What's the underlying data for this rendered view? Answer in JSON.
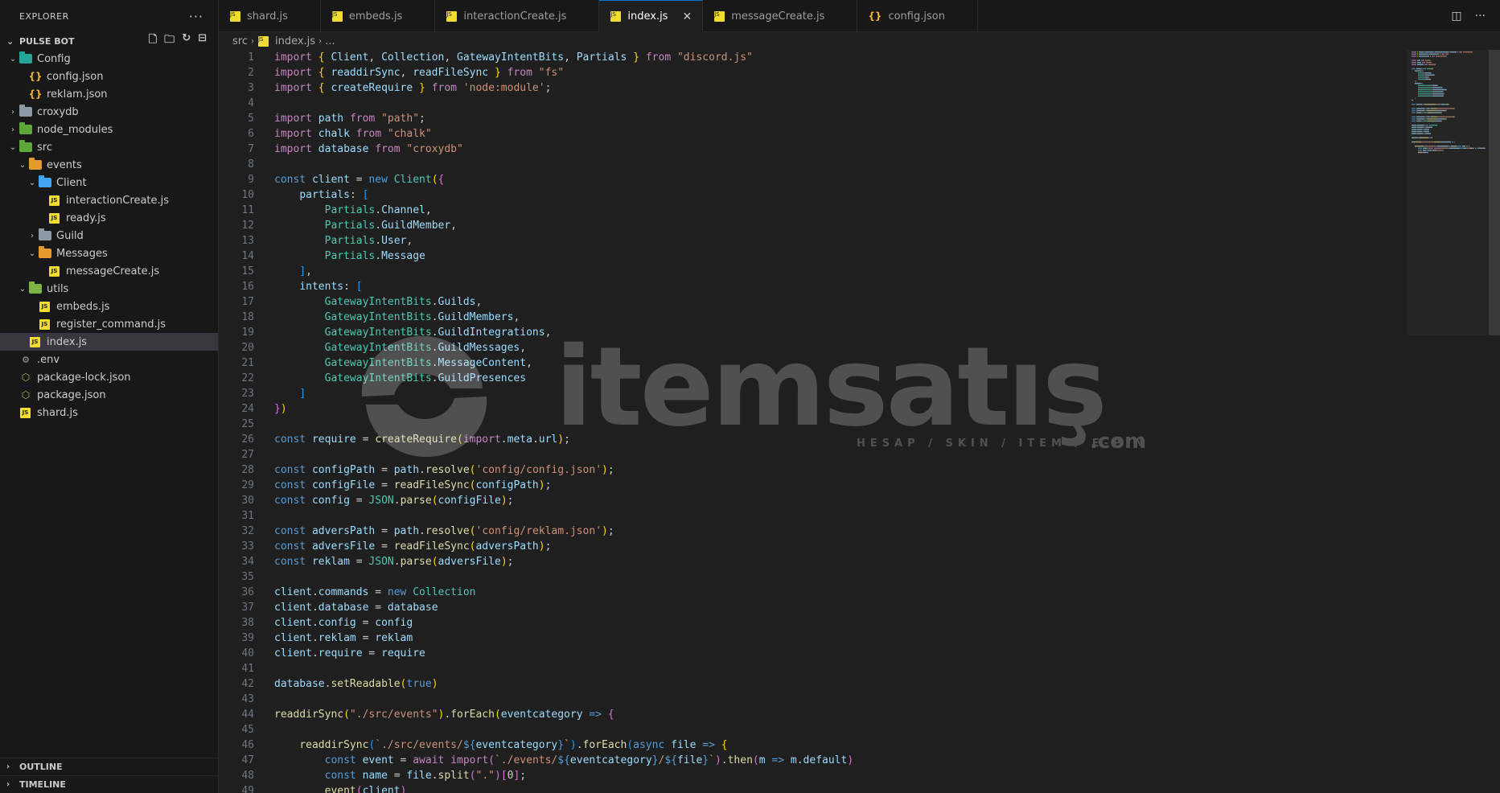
{
  "sidebar": {
    "title": "EXPLORER",
    "more_label": "···",
    "project": "PULSE BOT",
    "tree": [
      {
        "label": "Config",
        "depth": 1,
        "type": "folder",
        "color": "teal",
        "expanded": true
      },
      {
        "label": "config.json",
        "depth": 2,
        "type": "json"
      },
      {
        "label": "reklam.json",
        "depth": 2,
        "type": "json"
      },
      {
        "label": "croxydb",
        "depth": 1,
        "type": "folder",
        "color": "gray",
        "expanded": false
      },
      {
        "label": "node_modules",
        "depth": 1,
        "type": "folder",
        "color": "green",
        "expanded": false
      },
      {
        "label": "src",
        "depth": 1,
        "type": "folder",
        "color": "green",
        "expanded": true
      },
      {
        "label": "events",
        "depth": 2,
        "type": "folder",
        "color": "orange",
        "expanded": true
      },
      {
        "label": "Client",
        "depth": 3,
        "type": "folder",
        "color": "blue",
        "expanded": true
      },
      {
        "label": "interactionCreate.js",
        "depth": 4,
        "type": "js"
      },
      {
        "label": "ready.js",
        "depth": 4,
        "type": "js"
      },
      {
        "label": "Guild",
        "depth": 3,
        "type": "folder",
        "color": "gray",
        "expanded": false
      },
      {
        "label": "Messages",
        "depth": 3,
        "type": "folder",
        "color": "orange",
        "expanded": true
      },
      {
        "label": "messageCreate.js",
        "depth": 4,
        "type": "js"
      },
      {
        "label": "utils",
        "depth": 2,
        "type": "folder",
        "color": "olive",
        "expanded": true
      },
      {
        "label": "embeds.js",
        "depth": 3,
        "type": "js"
      },
      {
        "label": "register_command.js",
        "depth": 3,
        "type": "js"
      },
      {
        "label": "index.js",
        "depth": 2,
        "type": "js",
        "active": true
      },
      {
        "label": ".env",
        "depth": 1,
        "type": "env"
      },
      {
        "label": "package-lock.json",
        "depth": 1,
        "type": "pkg"
      },
      {
        "label": "package.json",
        "depth": 1,
        "type": "pkg"
      },
      {
        "label": "shard.js",
        "depth": 1,
        "type": "js"
      }
    ],
    "outline": "OUTLINE",
    "timeline": "TIMELINE"
  },
  "tabs": [
    {
      "label": "shard.js",
      "type": "js"
    },
    {
      "label": "embeds.js",
      "type": "js"
    },
    {
      "label": "interactionCreate.js",
      "type": "js"
    },
    {
      "label": "index.js",
      "type": "js",
      "active": true
    },
    {
      "label": "messageCreate.js",
      "type": "js"
    },
    {
      "label": "config.json",
      "type": "json"
    }
  ],
  "breadcrumb": {
    "folder": "src",
    "file": "index.js",
    "more": "..."
  },
  "watermark": {
    "brand": "itemsatış",
    "tagline": "HESAP / SKIN / ITEM / E-PIN",
    "suffix": ".com"
  },
  "code_lines": [
    [
      [
        "kw",
        "import"
      ],
      [
        "tx",
        " "
      ],
      [
        "br1",
        "{"
      ],
      [
        "tx",
        " "
      ],
      [
        "vr",
        "Client"
      ],
      [
        "tx",
        ", "
      ],
      [
        "vr",
        "Collection"
      ],
      [
        "tx",
        ", "
      ],
      [
        "vr",
        "GatewayIntentBits"
      ],
      [
        "tx",
        ", "
      ],
      [
        "vr",
        "Partials"
      ],
      [
        "tx",
        " "
      ],
      [
        "br1",
        "}"
      ],
      [
        "tx",
        " "
      ],
      [
        "kw",
        "from"
      ],
      [
        "tx",
        " "
      ],
      [
        "st",
        "\"discord.js\""
      ]
    ],
    [
      [
        "kw",
        "import"
      ],
      [
        "tx",
        " "
      ],
      [
        "br1",
        "{"
      ],
      [
        "tx",
        " "
      ],
      [
        "vr",
        "readdirSync"
      ],
      [
        "tx",
        ", "
      ],
      [
        "vr",
        "readFileSync"
      ],
      [
        "tx",
        " "
      ],
      [
        "br1",
        "}"
      ],
      [
        "tx",
        " "
      ],
      [
        "kw",
        "from"
      ],
      [
        "tx",
        " "
      ],
      [
        "st",
        "\"fs\""
      ]
    ],
    [
      [
        "kw",
        "import"
      ],
      [
        "tx",
        " "
      ],
      [
        "br1",
        "{"
      ],
      [
        "tx",
        " "
      ],
      [
        "vr",
        "createRequire"
      ],
      [
        "tx",
        " "
      ],
      [
        "br1",
        "}"
      ],
      [
        "tx",
        " "
      ],
      [
        "kw",
        "from"
      ],
      [
        "tx",
        " "
      ],
      [
        "st",
        "'node:module'"
      ],
      [
        "tx",
        ";"
      ]
    ],
    [],
    [
      [
        "kw",
        "import"
      ],
      [
        "tx",
        " "
      ],
      [
        "vr",
        "path"
      ],
      [
        "tx",
        " "
      ],
      [
        "kw",
        "from"
      ],
      [
        "tx",
        " "
      ],
      [
        "st",
        "\"path\""
      ],
      [
        "tx",
        ";"
      ]
    ],
    [
      [
        "kw",
        "import"
      ],
      [
        "tx",
        " "
      ],
      [
        "vr",
        "chalk"
      ],
      [
        "tx",
        " "
      ],
      [
        "kw",
        "from"
      ],
      [
        "tx",
        " "
      ],
      [
        "st",
        "\"chalk\""
      ]
    ],
    [
      [
        "kw",
        "import"
      ],
      [
        "tx",
        " "
      ],
      [
        "vr",
        "database"
      ],
      [
        "tx",
        " "
      ],
      [
        "kw",
        "from"
      ],
      [
        "tx",
        " "
      ],
      [
        "st",
        "\"croxydb\""
      ]
    ],
    [],
    [
      [
        "bl",
        "const"
      ],
      [
        "tx",
        " "
      ],
      [
        "vr",
        "client"
      ],
      [
        "tx",
        " = "
      ],
      [
        "bl",
        "new"
      ],
      [
        "tx",
        " "
      ],
      [
        "cl",
        "Client"
      ],
      [
        "br1",
        "("
      ],
      [
        "br2",
        "{"
      ]
    ],
    [
      [
        "tx",
        "    "
      ],
      [
        "vr",
        "partials"
      ],
      [
        "tx",
        ": "
      ],
      [
        "br3",
        "["
      ]
    ],
    [
      [
        "tx",
        "        "
      ],
      [
        "cl",
        "Partials"
      ],
      [
        "tx",
        "."
      ],
      [
        "vr",
        "Channel"
      ],
      [
        "tx",
        ","
      ]
    ],
    [
      [
        "tx",
        "        "
      ],
      [
        "cl",
        "Partials"
      ],
      [
        "tx",
        "."
      ],
      [
        "vr",
        "GuildMember"
      ],
      [
        "tx",
        ","
      ]
    ],
    [
      [
        "tx",
        "        "
      ],
      [
        "cl",
        "Partials"
      ],
      [
        "tx",
        "."
      ],
      [
        "vr",
        "User"
      ],
      [
        "tx",
        ","
      ]
    ],
    [
      [
        "tx",
        "        "
      ],
      [
        "cl",
        "Partials"
      ],
      [
        "tx",
        "."
      ],
      [
        "vr",
        "Message"
      ]
    ],
    [
      [
        "tx",
        "    "
      ],
      [
        "br3",
        "]"
      ],
      [
        "tx",
        ","
      ]
    ],
    [
      [
        "tx",
        "    "
      ],
      [
        "vr",
        "intents"
      ],
      [
        "tx",
        ": "
      ],
      [
        "br3",
        "["
      ]
    ],
    [
      [
        "tx",
        "        "
      ],
      [
        "cl",
        "GatewayIntentBits"
      ],
      [
        "tx",
        "."
      ],
      [
        "vr",
        "Guilds"
      ],
      [
        "tx",
        ","
      ]
    ],
    [
      [
        "tx",
        "        "
      ],
      [
        "cl",
        "GatewayIntentBits"
      ],
      [
        "tx",
        "."
      ],
      [
        "vr",
        "GuildMembers"
      ],
      [
        "tx",
        ","
      ]
    ],
    [
      [
        "tx",
        "        "
      ],
      [
        "cl",
        "GatewayIntentBits"
      ],
      [
        "tx",
        "."
      ],
      [
        "vr",
        "GuildIntegrations"
      ],
      [
        "tx",
        ","
      ]
    ],
    [
      [
        "tx",
        "        "
      ],
      [
        "cl",
        "GatewayIntentBits"
      ],
      [
        "tx",
        "."
      ],
      [
        "vr",
        "GuildMessages"
      ],
      [
        "tx",
        ","
      ]
    ],
    [
      [
        "tx",
        "        "
      ],
      [
        "cl",
        "GatewayIntentBits"
      ],
      [
        "tx",
        "."
      ],
      [
        "vr",
        "MessageContent"
      ],
      [
        "tx",
        ","
      ]
    ],
    [
      [
        "tx",
        "        "
      ],
      [
        "cl",
        "GatewayIntentBits"
      ],
      [
        "tx",
        "."
      ],
      [
        "vr",
        "GuildPresences"
      ]
    ],
    [
      [
        "tx",
        "    "
      ],
      [
        "br3",
        "]"
      ]
    ],
    [
      [
        "br2",
        "}"
      ],
      [
        "br1",
        ")"
      ]
    ],
    [],
    [
      [
        "bl",
        "const"
      ],
      [
        "tx",
        " "
      ],
      [
        "vr",
        "require"
      ],
      [
        "tx",
        " = "
      ],
      [
        "fn",
        "createRequire"
      ],
      [
        "br1",
        "("
      ],
      [
        "kw",
        "import"
      ],
      [
        "tx",
        "."
      ],
      [
        "vr",
        "meta"
      ],
      [
        "tx",
        "."
      ],
      [
        "vr",
        "url"
      ],
      [
        "br1",
        ")"
      ],
      [
        "tx",
        ";"
      ]
    ],
    [],
    [
      [
        "bl",
        "const"
      ],
      [
        "tx",
        " "
      ],
      [
        "vr",
        "configPath"
      ],
      [
        "tx",
        " = "
      ],
      [
        "vr",
        "path"
      ],
      [
        "tx",
        "."
      ],
      [
        "fn",
        "resolve"
      ],
      [
        "br1",
        "("
      ],
      [
        "st",
        "'config/config.json'"
      ],
      [
        "br1",
        ")"
      ],
      [
        "tx",
        ";"
      ]
    ],
    [
      [
        "bl",
        "const"
      ],
      [
        "tx",
        " "
      ],
      [
        "vr",
        "configFile"
      ],
      [
        "tx",
        " = "
      ],
      [
        "fn",
        "readFileSync"
      ],
      [
        "br1",
        "("
      ],
      [
        "vr",
        "configPath"
      ],
      [
        "br1",
        ")"
      ],
      [
        "tx",
        ";"
      ]
    ],
    [
      [
        "bl",
        "const"
      ],
      [
        "tx",
        " "
      ],
      [
        "vr",
        "config"
      ],
      [
        "tx",
        " = "
      ],
      [
        "cl",
        "JSON"
      ],
      [
        "tx",
        "."
      ],
      [
        "fn",
        "parse"
      ],
      [
        "br1",
        "("
      ],
      [
        "vr",
        "configFile"
      ],
      [
        "br1",
        ")"
      ],
      [
        "tx",
        ";"
      ]
    ],
    [],
    [
      [
        "bl",
        "const"
      ],
      [
        "tx",
        " "
      ],
      [
        "vr",
        "adversPath"
      ],
      [
        "tx",
        " = "
      ],
      [
        "vr",
        "path"
      ],
      [
        "tx",
        "."
      ],
      [
        "fn",
        "resolve"
      ],
      [
        "br1",
        "("
      ],
      [
        "st",
        "'config/reklam.json'"
      ],
      [
        "br1",
        ")"
      ],
      [
        "tx",
        ";"
      ]
    ],
    [
      [
        "bl",
        "const"
      ],
      [
        "tx",
        " "
      ],
      [
        "vr",
        "adversFile"
      ],
      [
        "tx",
        " = "
      ],
      [
        "fn",
        "readFileSync"
      ],
      [
        "br1",
        "("
      ],
      [
        "vr",
        "adversPath"
      ],
      [
        "br1",
        ")"
      ],
      [
        "tx",
        ";"
      ]
    ],
    [
      [
        "bl",
        "const"
      ],
      [
        "tx",
        " "
      ],
      [
        "vr",
        "reklam"
      ],
      [
        "tx",
        " = "
      ],
      [
        "cl",
        "JSON"
      ],
      [
        "tx",
        "."
      ],
      [
        "fn",
        "parse"
      ],
      [
        "br1",
        "("
      ],
      [
        "vr",
        "adversFile"
      ],
      [
        "br1",
        ")"
      ],
      [
        "tx",
        ";"
      ]
    ],
    [],
    [
      [
        "vr",
        "client"
      ],
      [
        "tx",
        "."
      ],
      [
        "vr",
        "commands"
      ],
      [
        "tx",
        " = "
      ],
      [
        "bl",
        "new"
      ],
      [
        "tx",
        " "
      ],
      [
        "cl",
        "Collection"
      ]
    ],
    [
      [
        "vr",
        "client"
      ],
      [
        "tx",
        "."
      ],
      [
        "vr",
        "database"
      ],
      [
        "tx",
        " = "
      ],
      [
        "vr",
        "database"
      ]
    ],
    [
      [
        "vr",
        "client"
      ],
      [
        "tx",
        "."
      ],
      [
        "vr",
        "config"
      ],
      [
        "tx",
        " = "
      ],
      [
        "vr",
        "config"
      ]
    ],
    [
      [
        "vr",
        "client"
      ],
      [
        "tx",
        "."
      ],
      [
        "vr",
        "reklam"
      ],
      [
        "tx",
        " = "
      ],
      [
        "vr",
        "reklam"
      ]
    ],
    [
      [
        "vr",
        "client"
      ],
      [
        "tx",
        "."
      ],
      [
        "vr",
        "require"
      ],
      [
        "tx",
        " = "
      ],
      [
        "vr",
        "require"
      ]
    ],
    [],
    [
      [
        "vr",
        "database"
      ],
      [
        "tx",
        "."
      ],
      [
        "fn",
        "setReadable"
      ],
      [
        "br1",
        "("
      ],
      [
        "bl",
        "true"
      ],
      [
        "br1",
        ")"
      ]
    ],
    [],
    [
      [
        "fn",
        "readdirSync"
      ],
      [
        "br1",
        "("
      ],
      [
        "st",
        "\"./src/events\""
      ],
      [
        "br1",
        ")"
      ],
      [
        "tx",
        "."
      ],
      [
        "fn",
        "forEach"
      ],
      [
        "br1",
        "("
      ],
      [
        "vr",
        "eventcategory"
      ],
      [
        "tx",
        " "
      ],
      [
        "bl",
        "=>"
      ],
      [
        "tx",
        " "
      ],
      [
        "br2",
        "{"
      ]
    ],
    [],
    [
      [
        "tx",
        "    "
      ],
      [
        "fn",
        "readdirSync"
      ],
      [
        "br3",
        "("
      ],
      [
        "st",
        "`./src/events/"
      ],
      [
        "bl",
        "${"
      ],
      [
        "vr",
        "eventcategory"
      ],
      [
        "bl",
        "}"
      ],
      [
        "st",
        "`"
      ],
      [
        "br3",
        ")"
      ],
      [
        "tx",
        "."
      ],
      [
        "fn",
        "forEach"
      ],
      [
        "br3",
        "("
      ],
      [
        "bl",
        "async"
      ],
      [
        "tx",
        " "
      ],
      [
        "vr",
        "file"
      ],
      [
        "tx",
        " "
      ],
      [
        "bl",
        "=>"
      ],
      [
        "tx",
        " "
      ],
      [
        "br1",
        "{"
      ]
    ],
    [
      [
        "tx",
        "        "
      ],
      [
        "bl",
        "const"
      ],
      [
        "tx",
        " "
      ],
      [
        "vr",
        "event"
      ],
      [
        "tx",
        " = "
      ],
      [
        "kw",
        "await"
      ],
      [
        "tx",
        " "
      ],
      [
        "kw",
        "import"
      ],
      [
        "br2",
        "("
      ],
      [
        "st",
        "`./events/"
      ],
      [
        "bl",
        "${"
      ],
      [
        "vr",
        "eventcategory"
      ],
      [
        "bl",
        "}"
      ],
      [
        "st",
        "/"
      ],
      [
        "bl",
        "${"
      ],
      [
        "vr",
        "file"
      ],
      [
        "bl",
        "}"
      ],
      [
        "st",
        "`"
      ],
      [
        "br2",
        ")"
      ],
      [
        "tx",
        "."
      ],
      [
        "fn",
        "then"
      ],
      [
        "br2",
        "("
      ],
      [
        "vr",
        "m"
      ],
      [
        "tx",
        " "
      ],
      [
        "bl",
        "=>"
      ],
      [
        "tx",
        " "
      ],
      [
        "vr",
        "m"
      ],
      [
        "tx",
        "."
      ],
      [
        "vr",
        "default"
      ],
      [
        "br2",
        ")"
      ]
    ],
    [
      [
        "tx",
        "        "
      ],
      [
        "bl",
        "const"
      ],
      [
        "tx",
        " "
      ],
      [
        "vr",
        "name"
      ],
      [
        "tx",
        " = "
      ],
      [
        "vr",
        "file"
      ],
      [
        "tx",
        "."
      ],
      [
        "fn",
        "split"
      ],
      [
        "br2",
        "("
      ],
      [
        "st",
        "\".\""
      ],
      [
        "br2",
        ")"
      ],
      [
        "br2",
        "["
      ],
      [
        "tx",
        "0"
      ],
      [
        "br2",
        "]"
      ],
      [
        "tx",
        ";"
      ]
    ],
    [
      [
        "tx",
        "        "
      ],
      [
        "fn",
        "event"
      ],
      [
        "br2",
        "("
      ],
      [
        "vr",
        "client"
      ],
      [
        "br2",
        ")"
      ]
    ]
  ]
}
